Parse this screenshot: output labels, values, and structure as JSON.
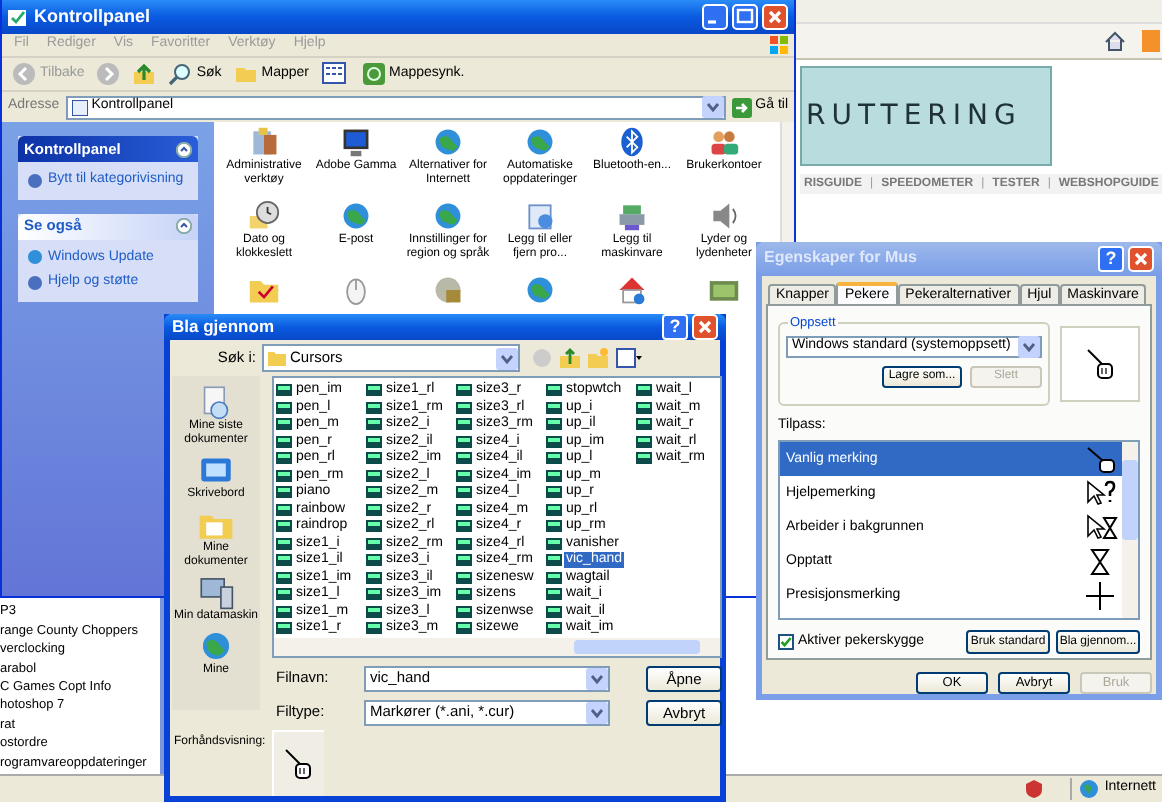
{
  "browser": {
    "banner": "RUTTERING",
    "nav": [
      {
        "kind": "link",
        "text": "RISGUIDE"
      },
      {
        "kind": "sep",
        "text": "|"
      },
      {
        "kind": "link",
        "text": "SPEEDOMETER"
      },
      {
        "kind": "sep",
        "text": "|"
      },
      {
        "kind": "link",
        "text": "TESTER"
      },
      {
        "kind": "sep",
        "text": "|"
      },
      {
        "kind": "link",
        "text": "WEBSHOPGUIDE"
      }
    ],
    "sidebar_items": [
      "P3",
      "range County Choppers",
      "verclocking",
      "arabol",
      "C Games Copt Info",
      "hotoshop 7",
      "rat",
      "ostordre",
      "rogramvareoppdateringer"
    ],
    "status_zone": "Internett"
  },
  "control_panel": {
    "title": "Kontrollpanel",
    "menu": [
      "Fil",
      "Rediger",
      "Vis",
      "Favoritter",
      "Verktøy",
      "Hjelp"
    ],
    "toolbar": [
      {
        "kind": "back",
        "label": "Tilbake"
      },
      {
        "kind": "forward"
      },
      {
        "kind": "up"
      },
      {
        "kind": "search",
        "label": "Søk"
      },
      {
        "kind": "folders",
        "label": "Mapper"
      },
      {
        "kind": "views"
      },
      {
        "kind": "sync",
        "label": "Mappesynk."
      }
    ],
    "address_label": "Adresse",
    "address": "Kontrollpanel",
    "go": "Gå til",
    "task_panels": [
      {
        "kind": "primary",
        "title": "Kontrollpanel",
        "links": [
          "Bytt til kategorivisning"
        ]
      },
      {
        "kind": "secondary",
        "title": "Se også",
        "links": [
          "Windows Update",
          "Hjelp og støtte"
        ]
      }
    ],
    "items": [
      "Administrative verktøy",
      "Adobe Gamma",
      "Alternativer for Internett",
      "Automatiske oppdateringer",
      "Bluetooth-en...",
      "Brukerkontoer",
      "Dato og klokkeslett",
      "E-post",
      "Innstillinger for region og språk",
      "Legg til eller fjern pro...",
      "Legg til maskinvare",
      "Lyder og lydenheter"
    ]
  },
  "file_dialog": {
    "title": "Bla gjennom",
    "help": "?",
    "look_in_label": "Søk i:",
    "look_in": "Cursors",
    "places": [
      "Mine siste dokumenter",
      "Skrivebord",
      "Mine dokumenter",
      "Min datamaskin",
      "Mine"
    ],
    "files": [
      {
        "name": "pen_im",
        "selected": false
      },
      {
        "name": "pen_l",
        "selected": false
      },
      {
        "name": "pen_m",
        "selected": false
      },
      {
        "name": "pen_r",
        "selected": false
      },
      {
        "name": "pen_rl",
        "selected": false
      },
      {
        "name": "pen_rm",
        "selected": false
      },
      {
        "name": "piano",
        "selected": false
      },
      {
        "name": "rainbow",
        "selected": false
      },
      {
        "name": "raindrop",
        "selected": false
      },
      {
        "name": "size1_i",
        "selected": false
      },
      {
        "name": "size1_il",
        "selected": false
      },
      {
        "name": "size1_im",
        "selected": false
      },
      {
        "name": "size1_l",
        "selected": false
      },
      {
        "name": "size1_m",
        "selected": false
      },
      {
        "name": "size1_r",
        "selected": false
      },
      {
        "name": "size1_rl",
        "selected": false
      },
      {
        "name": "size1_rm",
        "selected": false
      },
      {
        "name": "size2_i",
        "selected": false
      },
      {
        "name": "size2_il",
        "selected": false
      },
      {
        "name": "size2_im",
        "selected": false
      },
      {
        "name": "size2_l",
        "selected": false
      },
      {
        "name": "size2_m",
        "selected": false
      },
      {
        "name": "size2_r",
        "selected": false
      },
      {
        "name": "size2_rl",
        "selected": false
      },
      {
        "name": "size2_rm",
        "selected": false
      },
      {
        "name": "size3_i",
        "selected": false
      },
      {
        "name": "size3_il",
        "selected": false
      },
      {
        "name": "size3_im",
        "selected": false
      },
      {
        "name": "size3_l",
        "selected": false
      },
      {
        "name": "size3_m",
        "selected": false
      },
      {
        "name": "size3_r",
        "selected": false
      },
      {
        "name": "size3_rl",
        "selected": false
      },
      {
        "name": "size3_rm",
        "selected": false
      },
      {
        "name": "size4_i",
        "selected": false
      },
      {
        "name": "size4_il",
        "selected": false
      },
      {
        "name": "size4_im",
        "selected": false
      },
      {
        "name": "size4_l",
        "selected": false
      },
      {
        "name": "size4_m",
        "selected": false
      },
      {
        "name": "size4_r",
        "selected": false
      },
      {
        "name": "size4_rl",
        "selected": false
      },
      {
        "name": "size4_rm",
        "selected": false
      },
      {
        "name": "sizenesw",
        "selected": false
      },
      {
        "name": "sizens",
        "selected": false
      },
      {
        "name": "sizenwse",
        "selected": false
      },
      {
        "name": "sizewe",
        "selected": false
      },
      {
        "name": "stopwtch",
        "selected": false
      },
      {
        "name": "up_i",
        "selected": false
      },
      {
        "name": "up_il",
        "selected": false
      },
      {
        "name": "up_im",
        "selected": false
      },
      {
        "name": "up_l",
        "selected": false
      },
      {
        "name": "up_m",
        "selected": false
      },
      {
        "name": "up_r",
        "selected": false
      },
      {
        "name": "up_rl",
        "selected": false
      },
      {
        "name": "up_rm",
        "selected": false
      },
      {
        "name": "vanisher",
        "selected": false
      },
      {
        "name": "vic_hand",
        "selected": true
      },
      {
        "name": "wagtail",
        "selected": false
      },
      {
        "name": "wait_i",
        "selected": false
      },
      {
        "name": "wait_il",
        "selected": false
      },
      {
        "name": "wait_im",
        "selected": false
      },
      {
        "name": "wait_l",
        "selected": false
      },
      {
        "name": "wait_m",
        "selected": false
      },
      {
        "name": "wait_r",
        "selected": false
      },
      {
        "name": "wait_rl",
        "selected": false
      },
      {
        "name": "wait_rm",
        "selected": false
      }
    ],
    "filename_label": "Filnavn:",
    "filename": "vic_hand",
    "filetype_label": "Filtype:",
    "filetype": "Markører (*.ani, *.cur)",
    "open": "Åpne",
    "cancel": "Avbryt",
    "preview_label": "Forhåndsvisning:"
  },
  "mouse_dialog": {
    "title": "Egenskaper for Mus",
    "help": "?",
    "tabs": [
      {
        "label": "Knapper",
        "selected": false
      },
      {
        "label": "Pekere",
        "selected": true
      },
      {
        "label": "Pekeralternativer",
        "selected": false
      },
      {
        "label": "Hjul",
        "selected": false
      },
      {
        "label": "Maskinvare",
        "selected": false
      }
    ],
    "scheme_group": "Oppsett",
    "scheme": "Windows standard (systemoppsett)",
    "save_as": "Lagre som...",
    "delete": {
      "label": "Slett",
      "disabled": true
    },
    "customize_label": "Tilpass:",
    "cursors": [
      {
        "name": "Vanlig merking",
        "kind": "hand",
        "selected": true
      },
      {
        "name": "Hjelpemerking",
        "kind": "help",
        "selected": false
      },
      {
        "name": "Arbeider i bakgrunnen",
        "kind": "working",
        "selected": false
      },
      {
        "name": "Opptatt",
        "kind": "busy",
        "selected": false
      },
      {
        "name": "Presisjonsmerking",
        "kind": "cross",
        "selected": false
      }
    ],
    "shadow": {
      "label": "Aktiver pekerskygge",
      "checked": true
    },
    "use_default": "Bruk standard",
    "browse": "Bla gjennom...",
    "buttons": [
      {
        "label": "OK",
        "disabled": false
      },
      {
        "label": "Avbryt",
        "disabled": false
      },
      {
        "label": "Bruk",
        "disabled": true
      }
    ]
  }
}
